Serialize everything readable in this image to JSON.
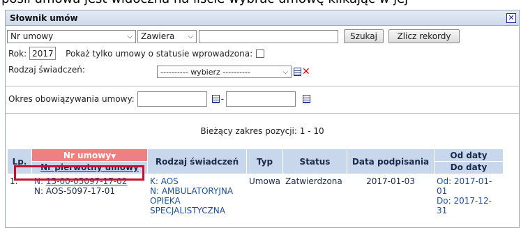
{
  "background_text": "pośli umowa jest widoczna na liście wybrać umowę klikając w jej",
  "dialog": {
    "title": "Słownik umów",
    "close_icon": "close-icon"
  },
  "search": {
    "field_select": "Nr umowy",
    "operator_select": "Zawiera",
    "query_value": "",
    "search_button": "Szukaj",
    "count_button": "Zlicz rekordy"
  },
  "filters": {
    "year_label": "Rok:",
    "year_value": "2017",
    "only_entered_label": "Pokaż tylko umowy o statusie wprowadzona:",
    "benefit_type_label": "Rodzaj świadczeń:",
    "benefit_type_select": "---------- wybierz ----------",
    "validity_label": "Okres obowiązywania umowy:",
    "date_from": "",
    "date_to": "",
    "date_separator": "-"
  },
  "range_text": "Bieżący zakres pozycji: 1 - 10",
  "table": {
    "headers": {
      "lp": "Lp.",
      "contract_no": "Nr umowy",
      "contract_no_sort": "▼",
      "original_no": "Nr pierwotny umowy",
      "benefit_type": "Rodzaj świadczeń",
      "type": "Typ",
      "status": "Status",
      "signed": "Data podpisania",
      "from": "Od daty",
      "to": "Do daty"
    },
    "rows": [
      {
        "lp": "1.",
        "nr_prefix": "N:",
        "nr": "15-00-05097-17-02",
        "orig": "N: AOS-5097-17-01",
        "benefit_code": "K: AOS",
        "benefit_name": "N: AMBULATORYJNA OPIEKA SPECJALISTYCZNA",
        "type": "Umowa",
        "status": "Zatwierdzona",
        "signed": "2017-01-03",
        "from": "Od: 2017-01-01",
        "to": "Do: 2017-12-31"
      }
    ]
  },
  "colors": {
    "header_bg": "#c9d7ec",
    "sorted_header_bg": "#f08080",
    "highlight_border": "#c8102e",
    "link": "#1a4fa0"
  }
}
